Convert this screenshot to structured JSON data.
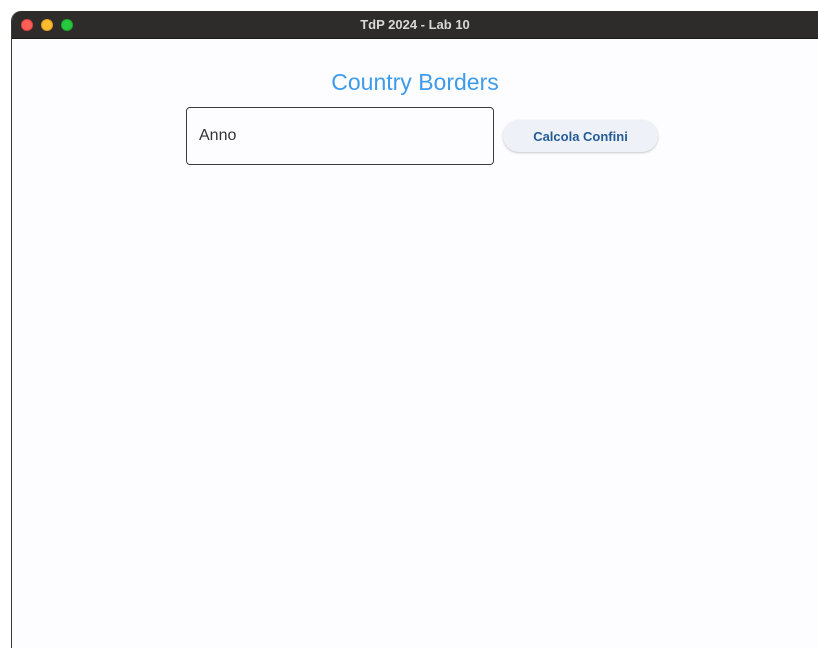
{
  "window": {
    "title": "TdP 2024 - Lab 10"
  },
  "main": {
    "title": "Country Borders",
    "year_input": {
      "placeholder": "Anno",
      "value": ""
    },
    "calculate_button": {
      "label": "Calcola Confini"
    }
  },
  "colors": {
    "title": "#3d9bec",
    "button_text": "#245c94",
    "button_bg": "#eef1f8",
    "titlebar": "#2e2c2b",
    "close": "#fe5f57",
    "minimize": "#febc2e",
    "zoom": "#28c840"
  }
}
